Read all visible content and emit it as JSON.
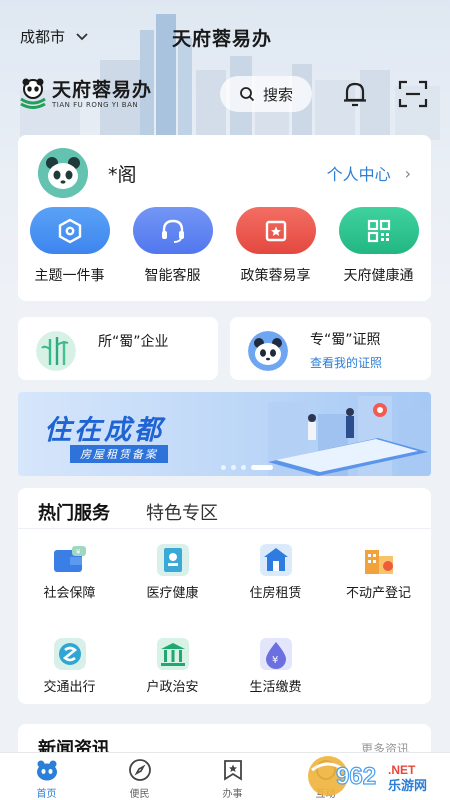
{
  "header": {
    "city": "成都市",
    "app_title": "天府蓉易办",
    "logo_cn": "天府蓉易办",
    "logo_en": "TIAN FU RONG YI BAN",
    "search_label": "搜索"
  },
  "profile": {
    "username": "*阁",
    "personal_center": "个人中心"
  },
  "quick_actions": [
    {
      "label": "主题一件事",
      "color": "#4b93f2"
    },
    {
      "label": "智能客服",
      "color": "#5f86f0"
    },
    {
      "label": "政策蓉易享",
      "color": "#ef5a50"
    },
    {
      "label": "天府健康通",
      "color": "#2fc493"
    }
  ],
  "cards": {
    "left_title": "所“蜀”企业",
    "right_title": "专“蜀”证照",
    "right_sub": "查看我的证照"
  },
  "banner": {
    "title": "住在成都",
    "subtitle": "房屋租赁备案"
  },
  "services": {
    "tabs": [
      "热门服务",
      "特色专区"
    ],
    "items": [
      {
        "label": "社会保障",
        "icon": "wallet-icon"
      },
      {
        "label": "医疗健康",
        "icon": "medical-card-icon"
      },
      {
        "label": "住房租赁",
        "icon": "house-icon"
      },
      {
        "label": "不动产登记",
        "icon": "building-icon"
      },
      {
        "label": "交通出行",
        "icon": "transport-icon"
      },
      {
        "label": "户政治安",
        "icon": "government-icon"
      },
      {
        "label": "生活缴费",
        "icon": "payment-icon"
      }
    ]
  },
  "news": {
    "title": "新闻资讯",
    "more": "更多资讯"
  },
  "bottom_nav": [
    {
      "label": "首页",
      "icon": "home-panda-icon"
    },
    {
      "label": "便民",
      "icon": "compass-icon"
    },
    {
      "label": "办事",
      "icon": "bookmark-star-icon"
    },
    {
      "label": "互动",
      "icon": "chat-icon"
    }
  ],
  "watermark": "962.NET 乐游网"
}
